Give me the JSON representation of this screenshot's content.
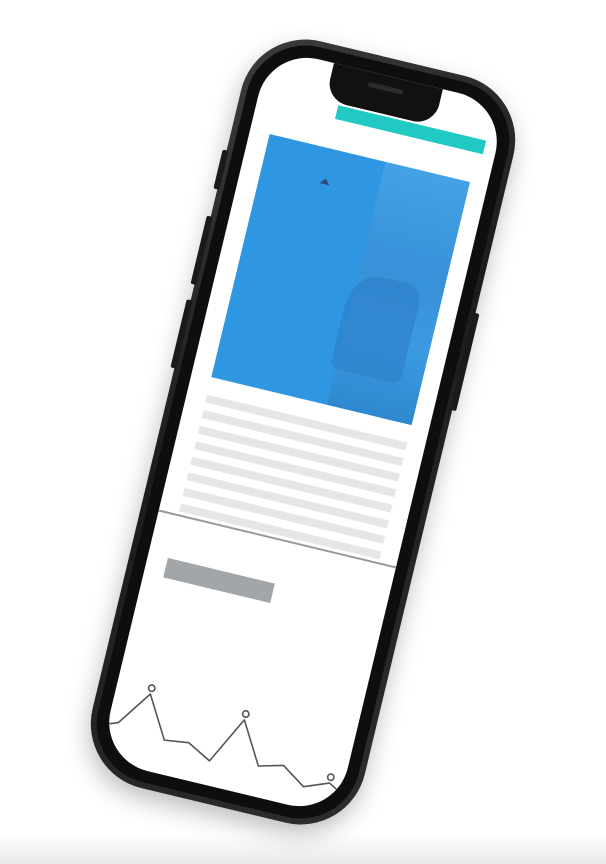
{
  "colors": {
    "header_accent": "#21c9c4",
    "hero_blue": "#2f96e2",
    "text_placeholder": "#e6e6e6",
    "button_placeholder": "#a2a6a8",
    "divider": "#9a9a9a",
    "phone_frame": "#1c1c1c",
    "sparkline": "#555555"
  },
  "icons": {
    "hero_mark": "triangle-icon"
  },
  "sparkline": {
    "values": [
      0.2,
      0.35,
      0.9,
      0.25,
      0.3,
      0.1,
      0.85,
      0.2,
      0.3,
      0.05,
      0.2,
      0.0
    ],
    "markers": [
      2,
      6,
      10
    ]
  }
}
